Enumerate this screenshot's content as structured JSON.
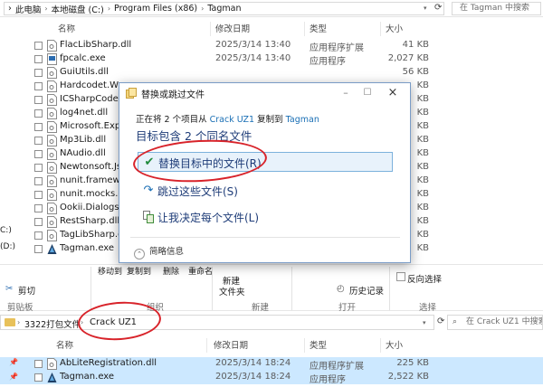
{
  "top_window": {
    "breadcrumb": [
      "此电脑",
      "本地磁盘 (C:)",
      "Program Files (x86)",
      "Tagman"
    ],
    "search_placeholder": "在 Tagman 中搜索",
    "columns": {
      "name": "名称",
      "date": "修改日期",
      "type": "类型",
      "size": "大小"
    },
    "files": [
      {
        "name": "FlacLibSharp.dll",
        "date": "2025/3/14 13:40",
        "type": "应用程序扩展",
        "size": "41 KB",
        "icon": "dll-file-icon"
      },
      {
        "name": "fpcalc.exe",
        "date": "2025/3/14 13:40",
        "type": "应用程序",
        "size": "2,027 KB",
        "icon": "exe-file-icon"
      },
      {
        "name": "GuiUtils.dll",
        "date": "",
        "type": "",
        "size": "56 KB",
        "icon": "dll-file-icon"
      },
      {
        "name": "Hardcodet.Wpf.",
        "date": "",
        "type": "",
        "size": "KB",
        "icon": "dll-file-icon"
      },
      {
        "name": "ICSharpCode.Sh",
        "date": "",
        "type": "",
        "size": "KB",
        "icon": "dll-file-icon"
      },
      {
        "name": "log4net.dll",
        "date": "",
        "type": "",
        "size": "KB",
        "icon": "dll-file-icon"
      },
      {
        "name": "Microsoft.Expre",
        "date": "",
        "type": "",
        "size": "KB",
        "icon": "dll-file-icon"
      },
      {
        "name": "Mp3Lib.dll",
        "date": "",
        "type": "",
        "size": "KB",
        "icon": "dll-file-icon"
      },
      {
        "name": "NAudio.dll",
        "date": "",
        "type": "",
        "size": "KB",
        "icon": "dll-file-icon"
      },
      {
        "name": "Newtonsoft.Json",
        "date": "",
        "type": "",
        "size": "KB",
        "icon": "dll-file-icon"
      },
      {
        "name": "nunit.framework",
        "date": "",
        "type": "",
        "size": "KB",
        "icon": "dll-file-icon"
      },
      {
        "name": "nunit.mocks.dll",
        "date": "",
        "type": "",
        "size": "KB",
        "icon": "dll-file-icon"
      },
      {
        "name": "Ookii.Dialogs.W",
        "date": "",
        "type": "",
        "size": "KB",
        "icon": "dll-file-icon"
      },
      {
        "name": "RestSharp.dll",
        "date": "",
        "type": "",
        "size": "KB",
        "icon": "dll-file-icon"
      },
      {
        "name": "TagLibSharp.dll",
        "date": "",
        "type": "",
        "size": "KB",
        "icon": "dll-file-icon"
      },
      {
        "name": "Tagman.exe",
        "date": "",
        "type": "",
        "size": "KB",
        "icon": "tagman-app-icon"
      }
    ],
    "nav_labels": [
      "C:)",
      "(D:)"
    ]
  },
  "ribbon": {
    "move_to": "移动到",
    "copy_to": "复制到",
    "delete": "删除",
    "rename": "重命名",
    "new_folder_line1": "新建",
    "new_folder_line2": "文件夹",
    "cut": "剪切",
    "history": "历史记录",
    "invert_selection": "反向选择",
    "sections": {
      "clipboard": "剪贴板",
      "organize": "组织",
      "new": "新建",
      "open": "打开",
      "select": "选择"
    }
  },
  "bottom_window": {
    "breadcrumb": [
      "3322打包文件",
      "Crack UZ1"
    ],
    "search_placeholder": "在 Crack UZ1 中搜索",
    "columns": {
      "name": "名称",
      "date": "修改日期",
      "type": "类型",
      "size": "大小"
    },
    "files": [
      {
        "name": "AbLiteRegistration.dll",
        "date": "2025/3/14 18:24",
        "type": "应用程序扩展",
        "size": "225 KB",
        "icon": "dll-file-icon"
      },
      {
        "name": "Tagman.exe",
        "date": "2025/3/14 18:24",
        "type": "应用程序",
        "size": "2,522 KB",
        "icon": "tagman-app-icon"
      }
    ]
  },
  "dialog": {
    "title": "替换或跳过文件",
    "info_prefix": "正在将 2 个项目从",
    "info_source": "Crack UZ1",
    "info_mid": "复制到",
    "info_dest": "Tagman",
    "heading": "目标包含 2 个同名文件",
    "option_replace": "替换目标中的文件(R)",
    "option_skip": "跳过这些文件(S)",
    "option_decide": "让我决定每个文件(L)",
    "details": "简略信息"
  },
  "colors": {
    "accent_link": "#1a6fb5",
    "heading_blue": "#1e3c78",
    "annotation_red": "#d8232a",
    "selected_option_bg": "#e8f2fb",
    "selected_row_bg": "#cce8ff"
  }
}
